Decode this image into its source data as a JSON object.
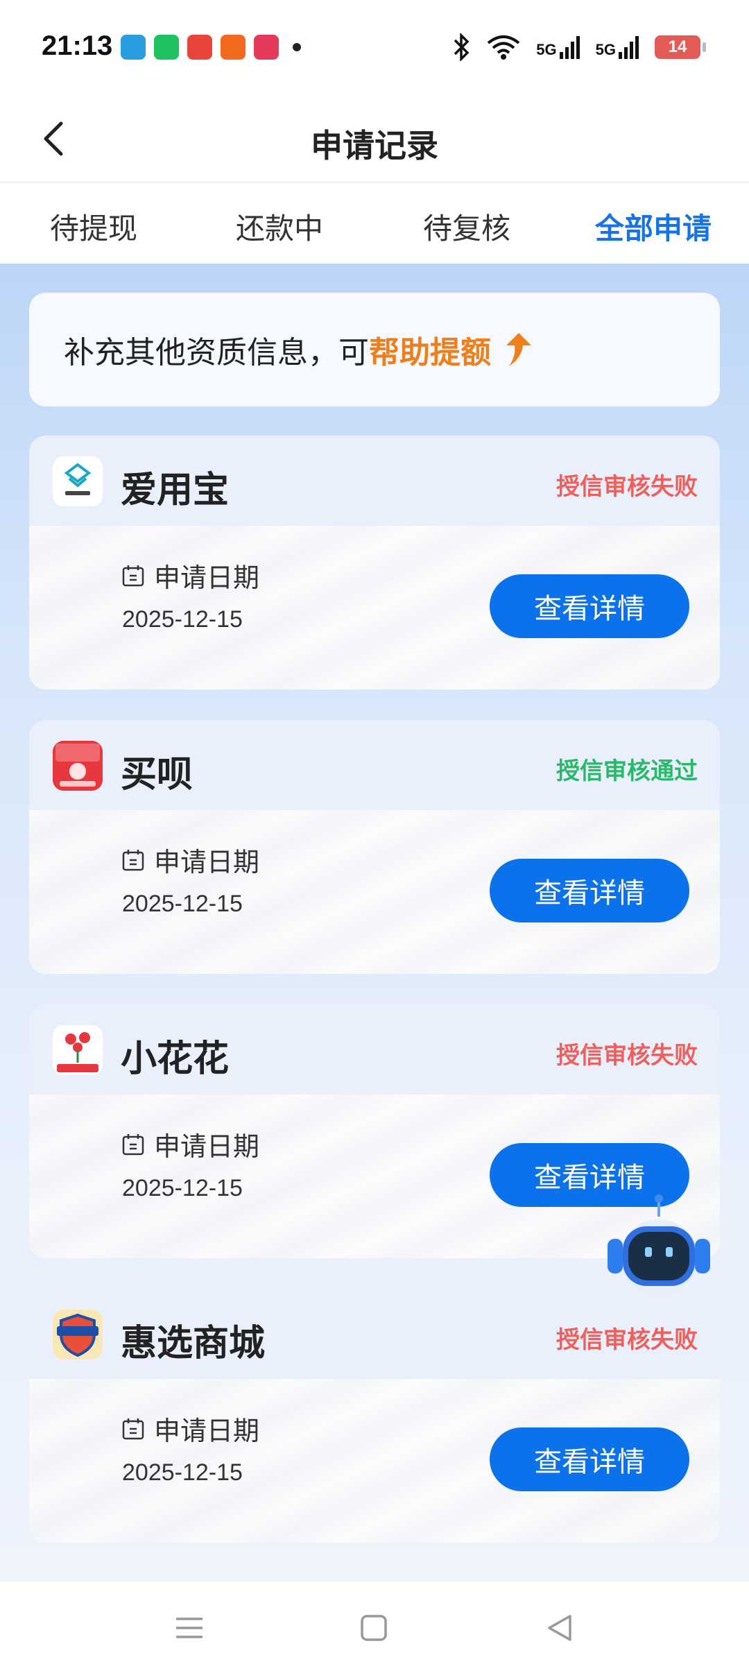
{
  "status_bar": {
    "time": "21:13",
    "signal_1": "5G",
    "signal_2": "5G",
    "battery": "14"
  },
  "header": {
    "title": "申请记录"
  },
  "tabs": [
    {
      "label": "待提现",
      "active": false
    },
    {
      "label": "还款中",
      "active": false
    },
    {
      "label": "待复核",
      "active": false
    },
    {
      "label": "全部申请",
      "active": true
    }
  ],
  "banner": {
    "text": "补充其他资质信息，可",
    "highlight": "帮助提额"
  },
  "cards": [
    {
      "name": "爱用宝",
      "status": "授信审核失败",
      "status_type": "fail",
      "date_label": "申请日期",
      "date": "2025-12-15",
      "button": "查看详情",
      "logo_text": "爱用宝"
    },
    {
      "name": "买呗",
      "status": "授信审核通过",
      "status_type": "pass",
      "date_label": "申请日期",
      "date": "2025-12-15",
      "button": "查看详情",
      "logo_text": "买呗"
    },
    {
      "name": "小花花",
      "status": "授信审核失败",
      "status_type": "fail",
      "date_label": "申请日期",
      "date": "2025-12-15",
      "button": "查看详情",
      "logo_text": "小花花"
    },
    {
      "name": "惠选商城",
      "status": "授信审核失败",
      "status_type": "fail",
      "date_label": "申请日期",
      "date": "2025-12-15",
      "button": "查看详情",
      "logo_text": "惠选商城"
    }
  ],
  "colors": {
    "accent": "#0b72ec",
    "fail": "#ef5f5c",
    "pass": "#2ab86b",
    "highlight": "#ef7f1a"
  }
}
